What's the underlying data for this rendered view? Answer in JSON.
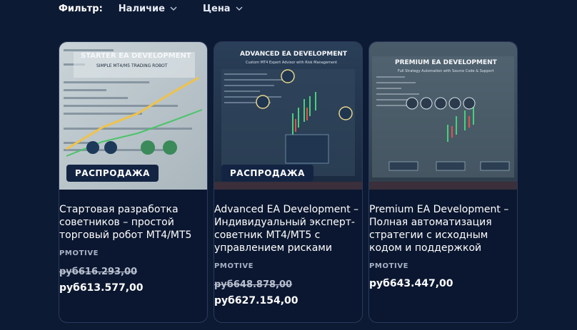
{
  "filter": {
    "label": "Фильтр:",
    "availability": "Наличие",
    "price": "Цена"
  },
  "products": [
    {
      "image_heading": "STARTER EA DEVELOPMENT",
      "image_subheading": "SIMPLE MT4/M5 TRADING ROBOT",
      "badge": "РАСПРОДАЖА",
      "title": "Стартовая разработка советников – простой торговый робот MT4/MT5",
      "vendor": "PMOTIVE",
      "price_old": "руб616.293,00",
      "price_new": "руб613.577,00"
    },
    {
      "image_heading": "ADVANCED EA DEVELOPMENT",
      "image_subheading": "Custom MT4 Expert Advisor with Risk Management",
      "badge": "РАСПРОДАЖА",
      "title": "Advanced EA Development – Индивидуальный эксперт-советник MT4/MT5 с управлением рисками",
      "vendor": "PMOTIVE",
      "price_old": "руб648.878,00",
      "price_new": "руб627.154,00"
    },
    {
      "image_heading": "PREMIUM EA DEVELOPMENT",
      "image_subheading": "Full Strategy Automation with Source Code & Support",
      "badge": "",
      "title": "Premium EA Development – Полная автоматизация стратегии с исходным кодом и поддержкой",
      "vendor": "PMOTIVE",
      "price_old": "",
      "price_new": "руб643.447,00"
    }
  ]
}
